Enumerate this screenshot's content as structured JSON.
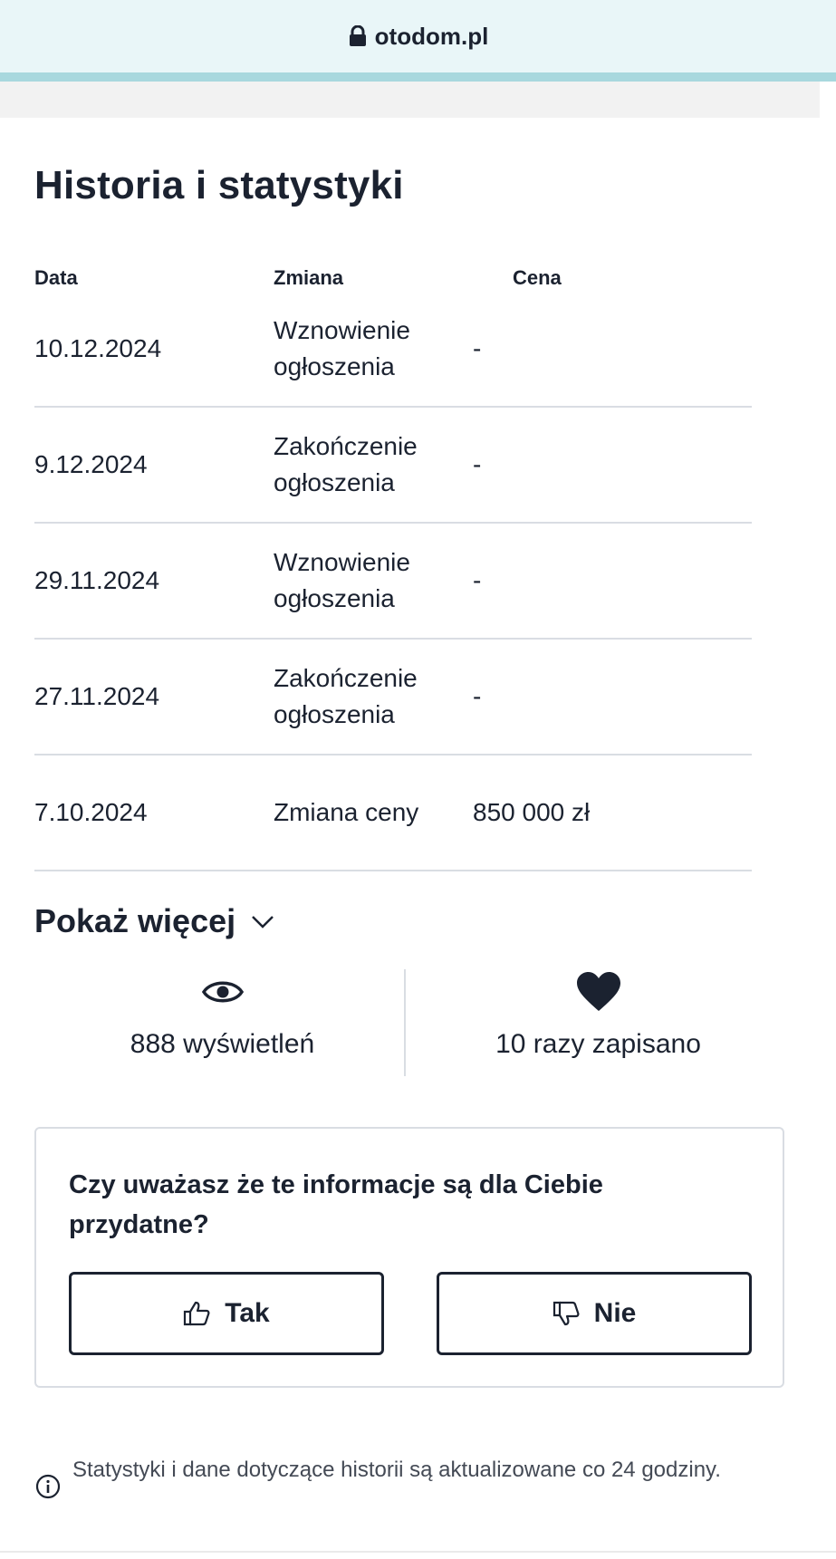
{
  "browser": {
    "url": "otodom.pl"
  },
  "history": {
    "title": "Historia i statystyki",
    "columns": [
      "Data",
      "Zmiana",
      "Cena"
    ],
    "rows": [
      {
        "date": "10.12.2024",
        "change": "Wznowienie ogłoszenia",
        "price": "-"
      },
      {
        "date": "9.12.2024",
        "change": "Zakończenie ogłoszenia",
        "price": "-"
      },
      {
        "date": "29.11.2024",
        "change": "Wznowienie ogłoszenia",
        "price": "-"
      },
      {
        "date": "27.11.2024",
        "change": "Zakończenie ogłoszenia",
        "price": "-"
      },
      {
        "date": "7.10.2024",
        "change": "Zmiana ceny",
        "price": "850 000 zł"
      }
    ],
    "show_more_label": "Pokaż więcej"
  },
  "stats": {
    "views_label": "888 wyświetleń",
    "views_icon": "eye-icon",
    "saves_label": "10 razy zapisano",
    "saves_icon": "heart-icon"
  },
  "feedback": {
    "question": "Czy uważasz że te informacje są dla Ciebie przydatne?",
    "yes_label": "Tak",
    "no_label": "Nie"
  },
  "info": {
    "text": "Statystyki i dane dotyczące historii są aktualizowane co 24 godziny."
  },
  "colors": {
    "text": "#1b2230",
    "urlbar_bg": "#e9f6f8",
    "urlbar_accent": "#a8d8de",
    "divider": "#d9dde3"
  }
}
